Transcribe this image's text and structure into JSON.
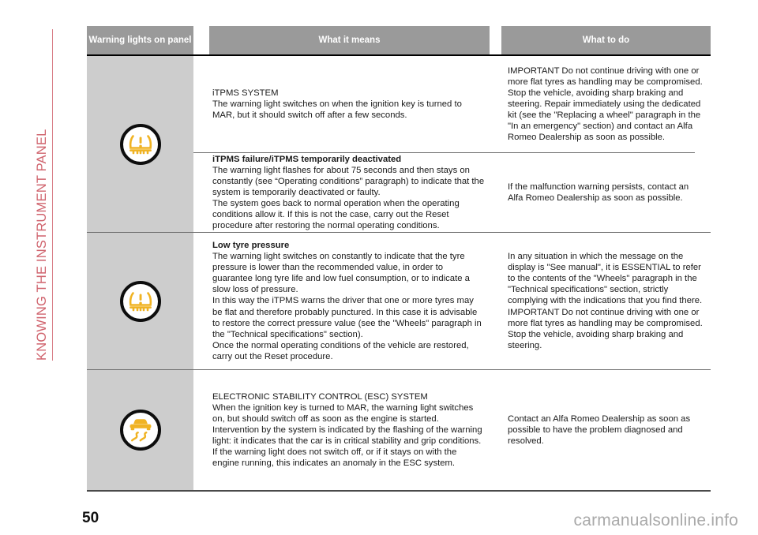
{
  "section_title": "KNOWING THE INSTRUMENT PANEL",
  "accent_color": "#d0646e",
  "header_bg": "#9a9a9a",
  "icon_cell_bg": "#cdcdcd",
  "warning_icon_color": "#f0b323",
  "table": {
    "headers": {
      "col1": "Warning lights on panel",
      "col2": "What it means",
      "col3": "What to do"
    },
    "rows": [
      {
        "icon": "tpms-warning-icon",
        "sub_rows": [
          {
            "title": "iTPMS SYSTEM",
            "title_bold": false,
            "body": "The warning light switches on when the ignition key is turned to MAR, but it should switch off after a few seconds.",
            "what_to_do": "IMPORTANT Do not continue driving with one or more flat tyres as handling may be compromised. Stop the vehicle, avoiding sharp braking and steering. Repair immediately using the dedicated kit (see the \"Replacing a wheel\" paragraph in the \"In an emergency\" section) and contact an Alfa Romeo Dealership as soon as possible."
          },
          {
            "title": "iTPMS failure/iTPMS temporarily deactivated",
            "title_bold": true,
            "body": "The warning light flashes for about 75 seconds and then stays on constantly (see “Operating conditions” paragraph) to indicate that the system is temporarily deactivated or faulty.\nThe system goes back to normal operation when the operating conditions allow it. If this is not the case, carry out the Reset procedure after restoring the normal operating conditions.",
            "what_to_do": "If the malfunction warning persists, contact an Alfa Romeo Dealership as soon as possible."
          }
        ]
      },
      {
        "icon": "tpms-warning-icon",
        "sub_rows": [
          {
            "title": "Low tyre pressure",
            "title_bold": true,
            "body": "The warning light switches on constantly to indicate that the tyre pressure is lower than the recommended value, in order to guarantee long tyre life and low fuel consumption, or to indicate a slow loss of pressure.\nIn this way the iTPMS warns the driver that one or more tyres may be flat and therefore probably punctured. In this case it is advisable to restore the correct pressure value (see the \"Wheels\" paragraph in the \"Technical specifications\" section).\nOnce the normal operating conditions of the vehicle are restored, carry out the Reset procedure.",
            "what_to_do": "In any situation in which the message on the display is \"See manual\", it is ESSENTIAL to refer to the contents of the \"Wheels\" paragraph in the \"Technical specifications\" section, strictly complying with the indications that you find there.\nIMPORTANT Do not continue driving with one or more flat tyres as handling may be compromised. Stop the vehicle, avoiding sharp braking and steering."
          }
        ]
      },
      {
        "icon": "esc-skid-car-icon",
        "sub_rows": [
          {
            "title": "ELECTRONIC STABILITY CONTROL (ESC) SYSTEM",
            "title_bold": false,
            "body": "When the ignition key is turned to MAR, the warning light switches on, but should switch off as soon as the engine is started.\nIntervention by the system is indicated by the flashing of the warning light: it indicates that the car is in critical stability and grip conditions.\nIf the warning light does not switch off, or if it stays on with the engine running, this indicates an anomaly in the ESC system.",
            "what_to_do": "Contact an Alfa Romeo Dealership as soon as possible to have the problem diagnosed and resolved."
          }
        ]
      }
    ]
  },
  "footer": {
    "page_number": "50",
    "watermark": "carmanualsonline.info"
  }
}
